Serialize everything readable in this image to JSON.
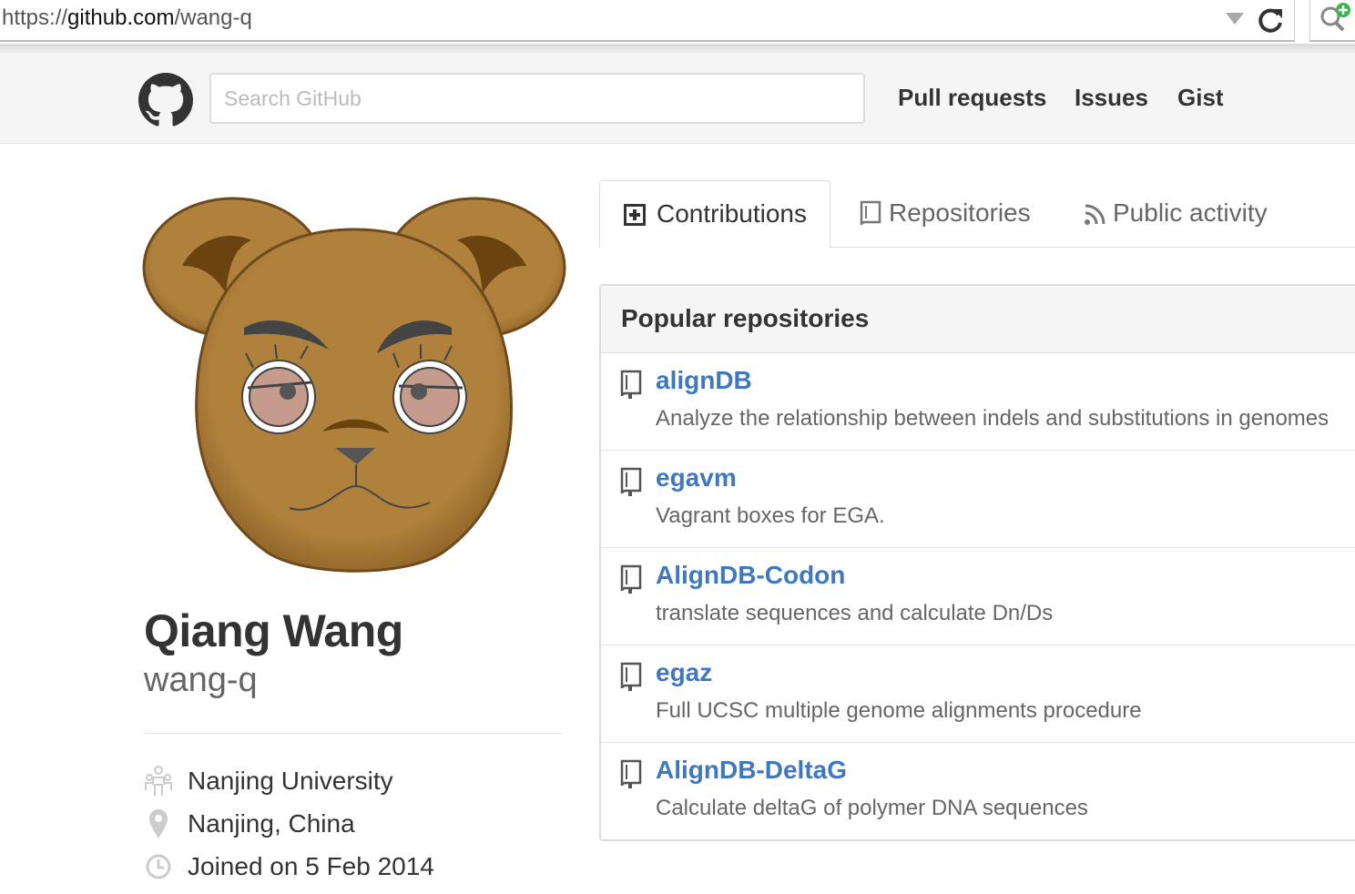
{
  "browser": {
    "url_scheme": "https://",
    "url_host": "github.com",
    "url_path": "/wang-q"
  },
  "header": {
    "logo_icon": "github-octocat-icon",
    "search_placeholder": "Search GitHub",
    "nav": [
      "Pull requests",
      "Issues",
      "Gist"
    ]
  },
  "profile": {
    "full_name": "Qiang Wang",
    "username": "wang-q",
    "details": [
      {
        "icon": "organization-icon",
        "text": "Nanjing University"
      },
      {
        "icon": "location-icon",
        "text": "Nanjing, China"
      },
      {
        "icon": "clock-icon",
        "text": "Joined on 5 Feb 2014"
      }
    ]
  },
  "tabs": [
    {
      "icon": "contributions-icon",
      "label": "Contributions",
      "selected": true
    },
    {
      "icon": "repo-icon",
      "label": "Repositories",
      "selected": false
    },
    {
      "icon": "rss-icon",
      "label": "Public activity",
      "selected": false
    }
  ],
  "popular_repos": {
    "title": "Popular repositories",
    "items": [
      {
        "name": "alignDB",
        "description": "Analyze the relationship between indels and substitutions in genomes"
      },
      {
        "name": "egavm",
        "description": "Vagrant boxes for EGA."
      },
      {
        "name": "AlignDB-Codon",
        "description": "translate sequences and calculate Dn/Ds"
      },
      {
        "name": "egaz",
        "description": "Full UCSC multiple genome alignments procedure"
      },
      {
        "name": "AlignDB-DeltaG",
        "description": "Calculate deltaG of polymer DNA sequences"
      }
    ]
  },
  "colors": {
    "link_blue": "#4078c0",
    "header_bg": "#f5f5f5",
    "bear_fur": "#b0813c"
  }
}
